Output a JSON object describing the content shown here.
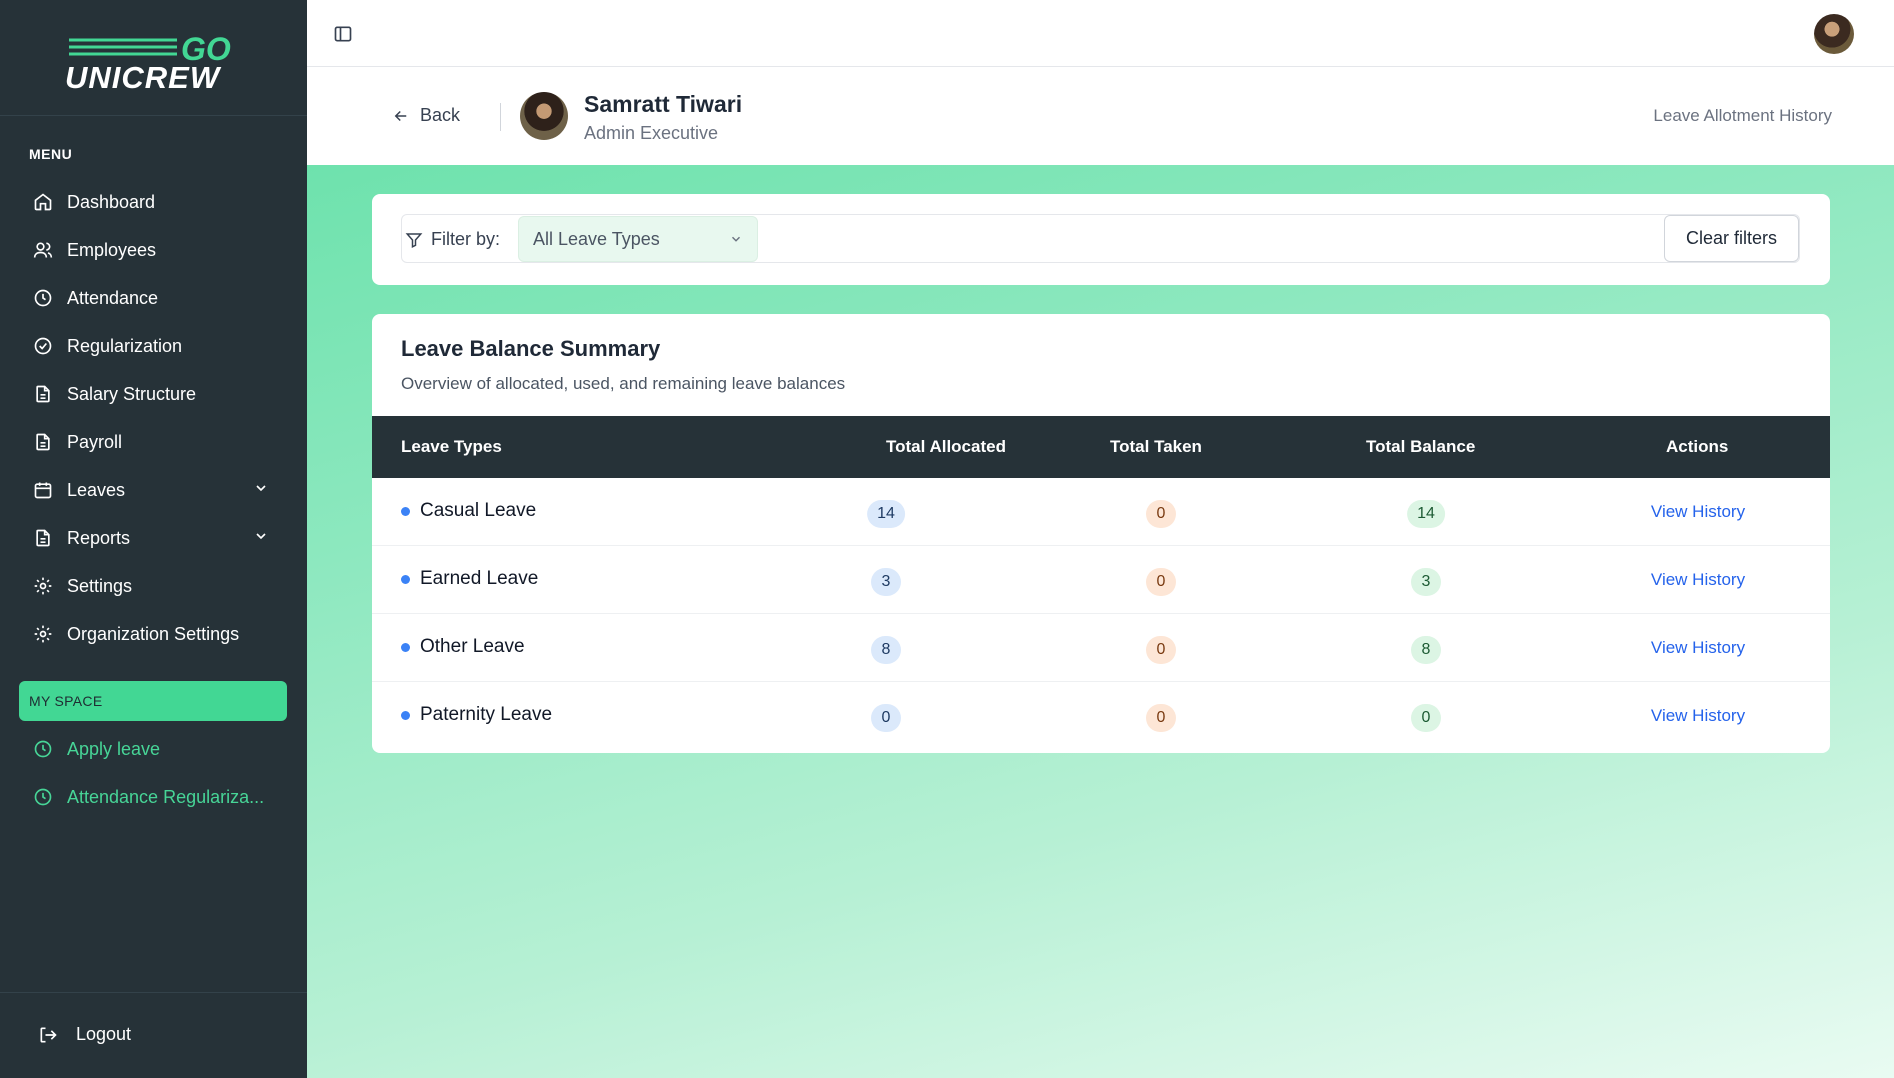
{
  "brand": {
    "logo_top": "GO",
    "logo_bottom": "UNICREW",
    "accent": "#42d794",
    "sidebar_bg": "#263238"
  },
  "sidebar": {
    "menu_heading": "MENU",
    "items": [
      {
        "label": "Dashboard",
        "icon": "home-icon"
      },
      {
        "label": "Employees",
        "icon": "users-icon"
      },
      {
        "label": "Attendance",
        "icon": "clock-icon"
      },
      {
        "label": "Regularization",
        "icon": "check-circle-icon"
      },
      {
        "label": "Salary Structure",
        "icon": "file-icon"
      },
      {
        "label": "Payroll",
        "icon": "file-icon"
      },
      {
        "label": "Leaves",
        "icon": "calendar-icon",
        "expandable": true
      },
      {
        "label": "Reports",
        "icon": "file-icon",
        "expandable": true
      },
      {
        "label": "Settings",
        "icon": "gear-icon"
      },
      {
        "label": "Organization Settings",
        "icon": "gear-icon"
      }
    ],
    "myspace_heading": "MY SPACE",
    "myspace_items": [
      {
        "label": "Apply leave",
        "icon": "clock-icon"
      },
      {
        "label": "Attendance Regulariza...",
        "icon": "clock-icon"
      }
    ],
    "logout_label": "Logout"
  },
  "header": {
    "back_label": "Back",
    "employee_name": "Samratt Tiwari",
    "employee_role": "Admin Executive",
    "page_link": "Leave Allotment History"
  },
  "filter": {
    "label": "Filter by:",
    "selected_type": "All Leave Types",
    "clear_label": "Clear filters"
  },
  "summary": {
    "title": "Leave Balance Summary",
    "subtitle": "Overview of allocated, used, and remaining leave balances",
    "columns": [
      "Leave Types",
      "Total Allocated",
      "Total Taken",
      "Total Balance",
      "Actions"
    ],
    "rows": [
      {
        "type": "Casual Leave",
        "allocated": "14",
        "taken": "0",
        "balance": "14",
        "action": "View History"
      },
      {
        "type": "Earned Leave",
        "allocated": "3",
        "taken": "0",
        "balance": "3",
        "action": "View History"
      },
      {
        "type": "Other Leave",
        "allocated": "8",
        "taken": "0",
        "balance": "8",
        "action": "View History"
      },
      {
        "type": "Paternity Leave",
        "allocated": "0",
        "taken": "0",
        "balance": "0",
        "action": "View History"
      }
    ]
  }
}
